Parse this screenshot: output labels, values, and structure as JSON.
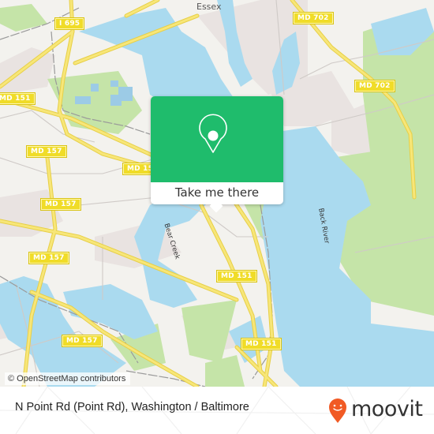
{
  "map": {
    "place_labels": [
      {
        "id": "essex",
        "text": "Essex"
      }
    ],
    "water_labels": [
      {
        "id": "back-river",
        "text": "Back River"
      },
      {
        "id": "bear-creek",
        "text": "Bear Creek"
      }
    ],
    "road_shields": [
      {
        "text": "I 695"
      },
      {
        "text": "MD 702"
      },
      {
        "text": "MD 702"
      },
      {
        "text": "MD 151"
      },
      {
        "text": "MD 157"
      },
      {
        "text": "MD 15"
      },
      {
        "text": "MD 157"
      },
      {
        "text": "MD 157"
      },
      {
        "text": "MD 151"
      },
      {
        "text": "MD 157"
      },
      {
        "text": "MD 151"
      }
    ],
    "colors": {
      "water": "#aadaef",
      "land": "#f3f2ee",
      "park": "#c5e4a8",
      "urban": "#e9e3e1",
      "road_major": "#f5e162",
      "popup_green": "#1fbc6c",
      "moovit_orange": "#f15a24"
    }
  },
  "popup": {
    "icon": "map-pin-icon",
    "button_label": "Take me there"
  },
  "attribution": "© OpenStreetMap contributors",
  "footer": {
    "location_title": "N Point Rd (Point Rd), Washington / Baltimore",
    "brand": "moovit",
    "brand_icon": "moovit-pin-icon"
  }
}
